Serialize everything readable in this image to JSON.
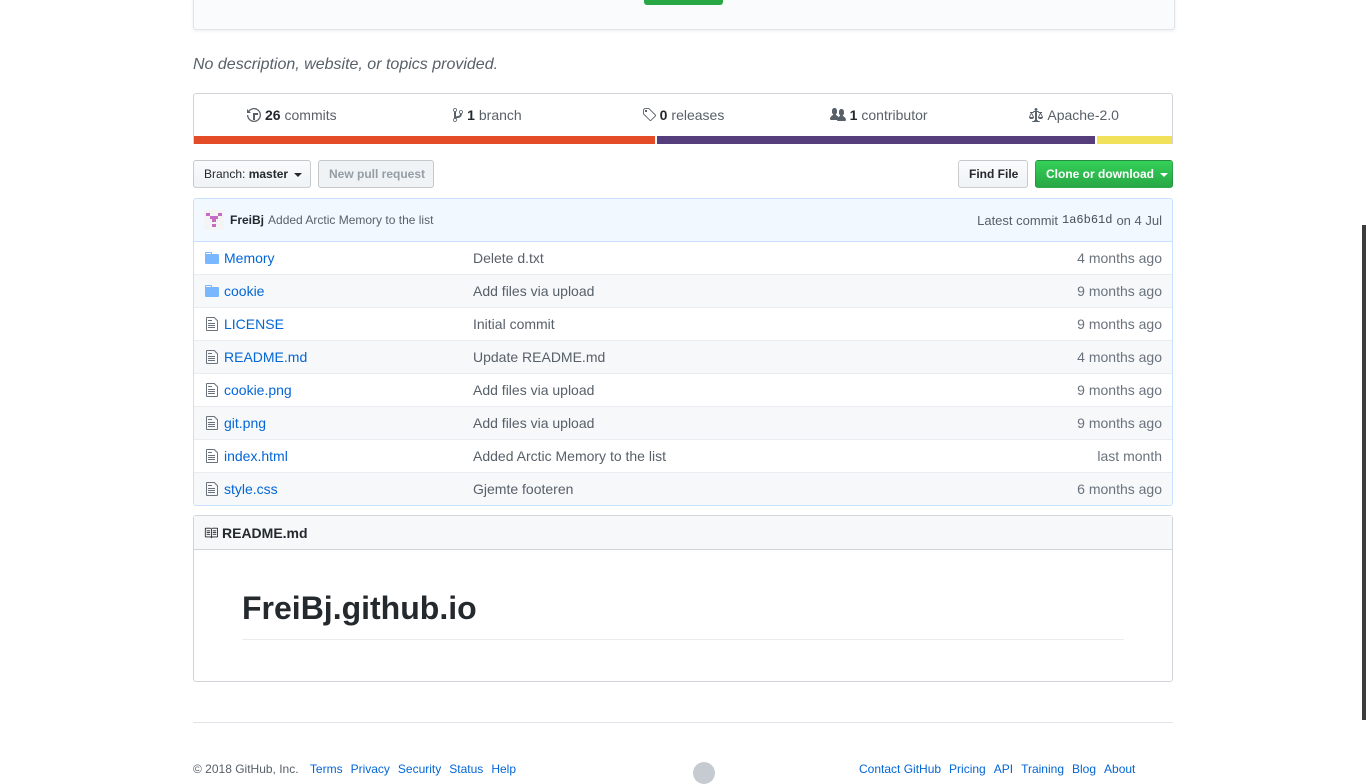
{
  "description": "No description, website, or topics provided.",
  "summary": {
    "commits": {
      "count": "26",
      "label": "commits"
    },
    "branches": {
      "count": "1",
      "label": "branch"
    },
    "releases": {
      "count": "0",
      "label": "releases"
    },
    "contributors": {
      "count": "1",
      "label": "contributor"
    },
    "license": "Apache-2.0"
  },
  "language_bar": [
    {
      "color": "#e34c26",
      "fraction": 0.473
    },
    {
      "color": "#563d7c",
      "fraction": 0.45
    },
    {
      "color": "#f1e05a",
      "fraction": 0.077
    }
  ],
  "toolbar": {
    "branch_prefix": "Branch:",
    "branch_name": "master",
    "new_pull_request": "New pull request",
    "find_file": "Find File",
    "clone": "Clone or download"
  },
  "commit": {
    "author": "FreiBj",
    "message": "Added Arctic Memory to the list",
    "latest_label": "Latest commit",
    "sha": "1a6b61d",
    "date": "on 4 Jul"
  },
  "files": [
    {
      "type": "folder",
      "name": "Memory",
      "message": "Delete d.txt",
      "age": "4 months ago"
    },
    {
      "type": "folder",
      "name": "cookie",
      "message": "Add files via upload",
      "age": "9 months ago"
    },
    {
      "type": "file",
      "name": "LICENSE",
      "message": "Initial commit",
      "age": "9 months ago"
    },
    {
      "type": "file",
      "name": "README.md",
      "message": "Update README.md",
      "age": "4 months ago"
    },
    {
      "type": "file",
      "name": "cookie.png",
      "message": "Add files via upload",
      "age": "9 months ago"
    },
    {
      "type": "file",
      "name": "git.png",
      "message": "Add files via upload",
      "age": "9 months ago"
    },
    {
      "type": "file",
      "name": "index.html",
      "message": "Added Arctic Memory to the list",
      "age": "last month"
    },
    {
      "type": "file",
      "name": "style.css",
      "message": "Gjemte footeren",
      "age": "6 months ago"
    }
  ],
  "readme": {
    "filename": "README.md",
    "heading": "FreiBj.github.io"
  },
  "footer": {
    "copyright": "© 2018 GitHub, Inc.",
    "left_links": [
      "Terms",
      "Privacy",
      "Security",
      "Status",
      "Help"
    ],
    "right_links": [
      "Contact GitHub",
      "Pricing",
      "API",
      "Training",
      "Blog",
      "About"
    ]
  }
}
